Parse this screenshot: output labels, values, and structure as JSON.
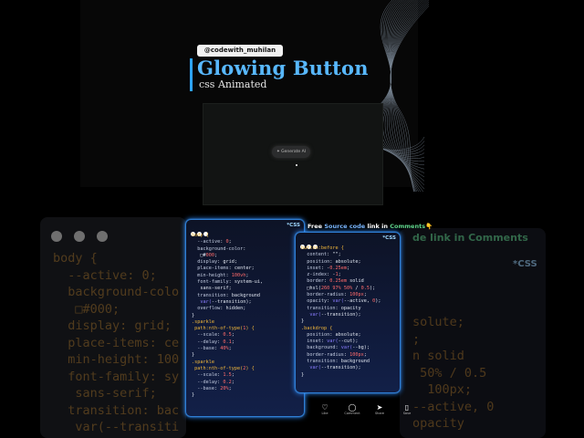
{
  "header": {
    "handle": "@codewith_muhilan",
    "title": "Glowing Button",
    "subtitle": "css Animated"
  },
  "preview": {
    "button_label": "Generate AI"
  },
  "code_left": {
    "lines": [
      "body {",
      "  --active: 0;",
      "  background-color:",
      "   □#000;",
      "  display: grid;",
      "  place-items: center;",
      "  min-height: 100vh;",
      "  font-family: system-ui,",
      "   sans-serif;",
      "  transition: background",
      "   var(--transition);",
      "  overflow: hidden;",
      "}",
      ".sparkle",
      " path:nth-of-type(1) {",
      "  --scale: 0.5;",
      "  --delay: 0.1;",
      "  --base: 40%;",
      "}",
      ".sparkle",
      " path:nth-of-type(2) {",
      "  --scale: 1.5;",
      "  --delay: 0.2;",
      "  --base: 20%;",
      "}"
    ]
  },
  "code_right": {
    "lines": [
      "button:before {",
      "  content: \"\";",
      "  position: absolute;",
      "  inset: -0.25em;",
      "  z-index: -1;",
      "  border: 0.25em solid",
      "  □hsl(260 97% 50% / 0.5);",
      "  border-radius: 100px;",
      "  opacity: var(--active, 0);",
      "  transition: opacity",
      "   var(--transition);",
      "}",
      ".backdrop {",
      "  position: absolute;",
      "  inset: var(--cut);",
      "  background: var(--bg);",
      "  border-radius: 100px;",
      "  transition: background",
      "   var(--transition);",
      "}"
    ]
  },
  "css_label": "*CSS",
  "banner": {
    "pre": "Free ",
    "source": "Source code",
    "mid": " link in ",
    "comments": "Comments",
    "emoji": "👇"
  },
  "actions": [
    {
      "icon": "♡",
      "label": "Like"
    },
    {
      "icon": "◯",
      "label": "Comment"
    },
    {
      "icon": "➤",
      "label": "Share"
    },
    {
      "icon": "▯",
      "label": "Save"
    }
  ],
  "bg_code_left": {
    "lines": [
      "body {",
      "  --active: 0;",
      "  background-colo",
      "   □#000;",
      "  display: grid;",
      "  place-items: ce",
      "  min-height: 100",
      "  font-family: sy",
      "   sans-serif;",
      "  transition: bac",
      "   var(--transiti"
    ]
  },
  "bg_code_right": {
    "lines": [
      "solute;",
      ";",
      "",
      "n solid",
      " 50% / 0.5",
      "  100px;",
      "--active, 0",
      "opacity"
    ]
  },
  "bg_banner": "de link in Comments",
  "colors": {
    "accent_blue": "#2ea3ff",
    "title_blue": "#58b8ff",
    "card_glow": "#2d8cff"
  }
}
